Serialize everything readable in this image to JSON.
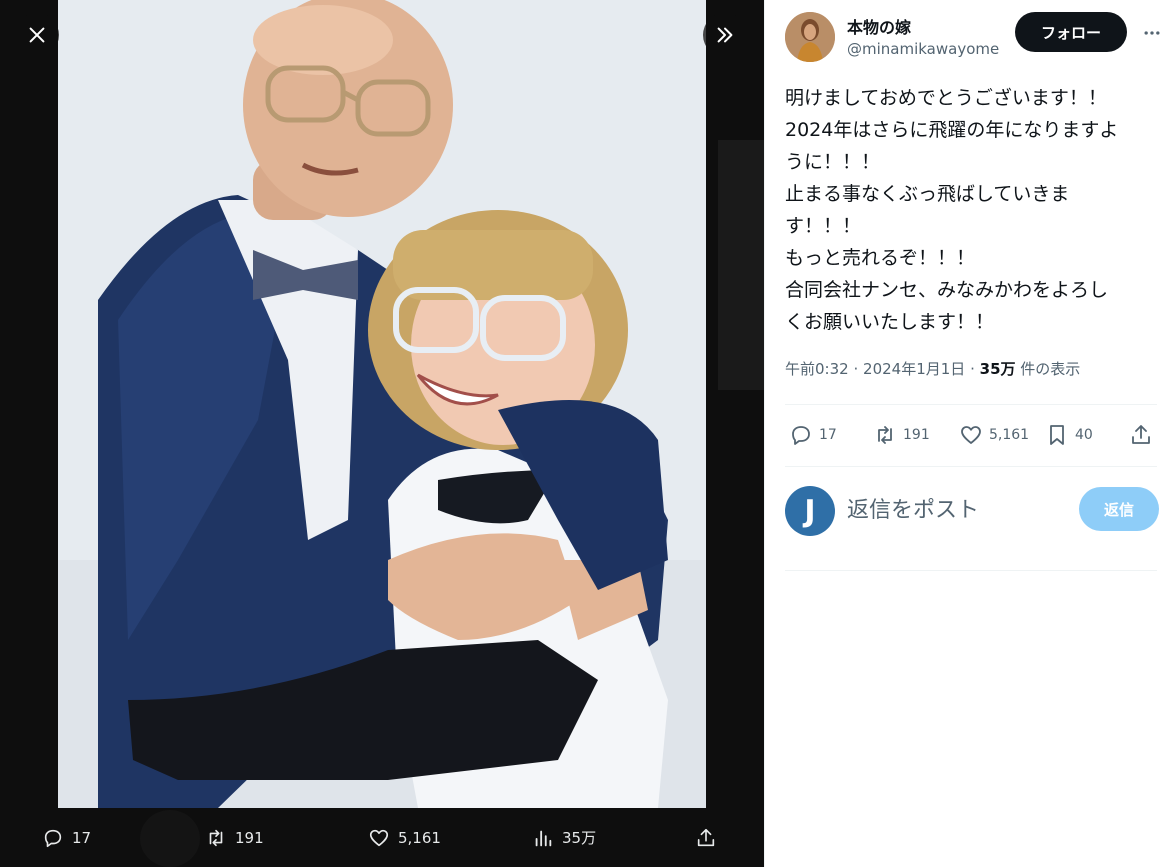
{
  "viewer": {
    "close_icon": "close-icon",
    "expand_icon": "chevrons-right-icon",
    "photo_alt": "",
    "bar": {
      "replies": "17",
      "retweets": "191",
      "likes": "5,161",
      "views": "35万"
    }
  },
  "tweet": {
    "display_name": "本物の嫁",
    "handle": "@minamikawayome",
    "follow_label": "フォロー",
    "more_icon": "more-horizontal-icon",
    "text_lines": [
      "明けましておめでとうございます！！",
      "2024年はさらに飛躍の年になりますよ",
      "うに！！！",
      "止まる事なくぶっ飛ばしていきま",
      "す！！！",
      "もっと売れるぞ！！！",
      "合同会社ナンセ、みなみかわをよろし",
      "くお願いいたします！！"
    ],
    "time": "午前0:32",
    "date": "2024年1月1日",
    "dot": "·",
    "views_count": "35万",
    "views_label": "件の表示",
    "actions": {
      "replies": "17",
      "retweets": "191",
      "likes": "5,161",
      "bookmarks": "40"
    }
  },
  "reply": {
    "avatar_letter": "J",
    "placeholder": "返信をポスト",
    "button_label": "返信"
  },
  "colors": {
    "accent": "#1d9bf0",
    "reply_button": "#8ecdf8",
    "follow_button": "#0f1419",
    "muted_text": "#536471"
  }
}
